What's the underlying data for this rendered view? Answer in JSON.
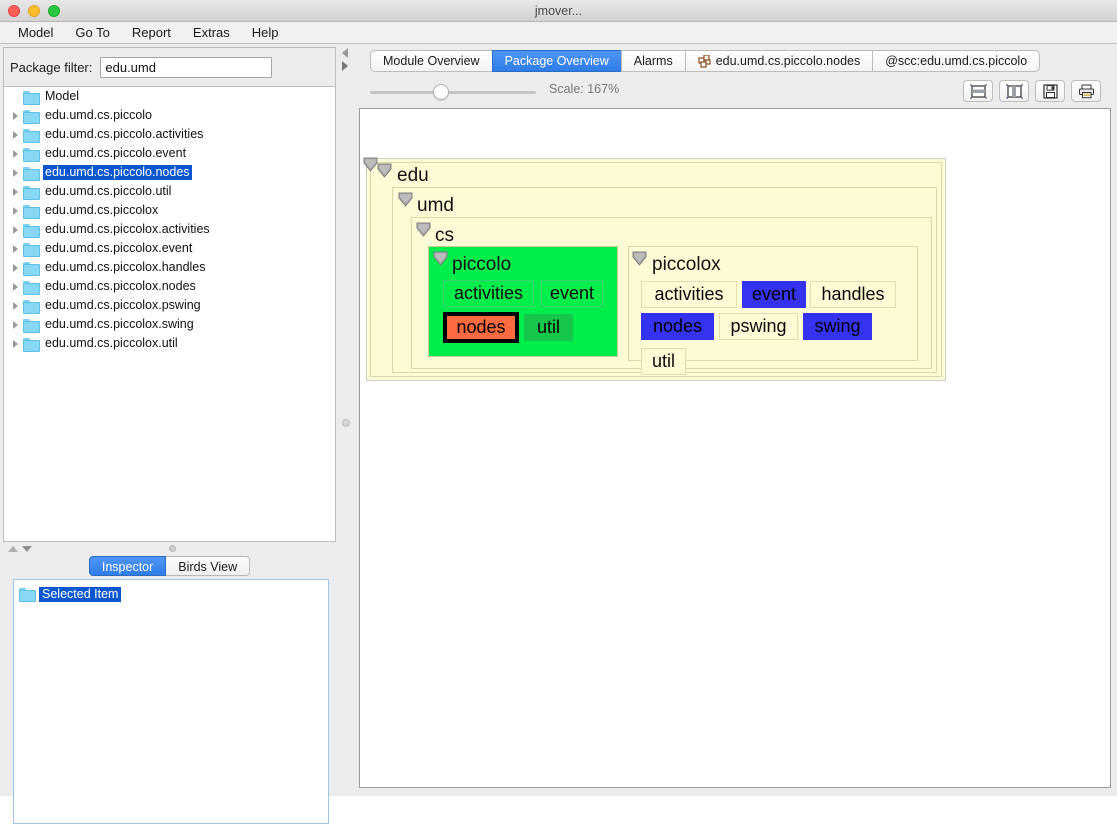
{
  "window": {
    "title": "jmover..."
  },
  "menubar": {
    "items": [
      "Model",
      "Go To",
      "Report",
      "Extras",
      "Help"
    ]
  },
  "left": {
    "filter": {
      "label": "Package filter:",
      "value": "edu.umd",
      "placeholder": ""
    },
    "tree": {
      "root": "Model",
      "items": [
        {
          "label": "edu.umd.cs.piccolo",
          "selected": false
        },
        {
          "label": "edu.umd.cs.piccolo.activities",
          "selected": false
        },
        {
          "label": "edu.umd.cs.piccolo.event",
          "selected": false
        },
        {
          "label": "edu.umd.cs.piccolo.nodes",
          "selected": true
        },
        {
          "label": "edu.umd.cs.piccolo.util",
          "selected": false
        },
        {
          "label": "edu.umd.cs.piccolox",
          "selected": false
        },
        {
          "label": "edu.umd.cs.piccolox.activities",
          "selected": false
        },
        {
          "label": "edu.umd.cs.piccolox.event",
          "selected": false
        },
        {
          "label": "edu.umd.cs.piccolox.handles",
          "selected": false
        },
        {
          "label": "edu.umd.cs.piccolox.nodes",
          "selected": false
        },
        {
          "label": "edu.umd.cs.piccolox.pswing",
          "selected": false
        },
        {
          "label": "edu.umd.cs.piccolox.swing",
          "selected": false
        },
        {
          "label": "edu.umd.cs.piccolox.util",
          "selected": false
        }
      ]
    },
    "inspector": {
      "tabs": [
        {
          "label": "Inspector",
          "active": true
        },
        {
          "label": "Birds View",
          "active": false
        }
      ],
      "selected_item": "Selected Item"
    }
  },
  "right": {
    "tabs": [
      {
        "label": "Module Overview",
        "active": false,
        "icon": ""
      },
      {
        "label": "Package Overview",
        "active": true,
        "icon": ""
      },
      {
        "label": "Alarms",
        "active": false,
        "icon": ""
      },
      {
        "label": "edu.umd.cs.piccolo.nodes",
        "active": false,
        "icon": "grid-icon"
      },
      {
        "label": "@scc:edu.umd.cs.piccolo",
        "active": false,
        "icon": ""
      }
    ],
    "toolbar": {
      "scale_label": "Scale: 167%",
      "scale_percent": 167,
      "buttons": [
        {
          "name": "horizontal-layout-button"
        },
        {
          "name": "vertical-layout-button"
        },
        {
          "name": "save-button"
        },
        {
          "name": "print-button"
        }
      ]
    },
    "diagram": {
      "levels": [
        {
          "name": "edu"
        },
        {
          "name": "umd"
        },
        {
          "name": "cs"
        }
      ],
      "packages": [
        {
          "name": "piccolo",
          "highlight": "green",
          "children": [
            {
              "label": "activities",
              "state": "normal"
            },
            {
              "label": "event",
              "state": "normal"
            },
            {
              "label": "nodes",
              "state": "selected-orange"
            },
            {
              "label": "util",
              "state": "green"
            }
          ]
        },
        {
          "name": "piccolox",
          "highlight": "none",
          "children": [
            {
              "label": "activities",
              "state": "normal"
            },
            {
              "label": "event",
              "state": "blue"
            },
            {
              "label": "handles",
              "state": "normal"
            },
            {
              "label": "nodes",
              "state": "blue"
            },
            {
              "label": "pswing",
              "state": "normal"
            },
            {
              "label": "swing",
              "state": "blue"
            },
            {
              "label": "util",
              "state": "normal"
            }
          ]
        }
      ]
    }
  },
  "colors": {
    "accent_blue": "#2f7de8",
    "selection_blue": "#0b57d0",
    "node_yellow": "#fbfbd5",
    "highlight_green": "#00ee4c",
    "leaf_green": "#16c64a",
    "leaf_blue": "#3633f0",
    "leaf_orange": "#fc6a42"
  }
}
